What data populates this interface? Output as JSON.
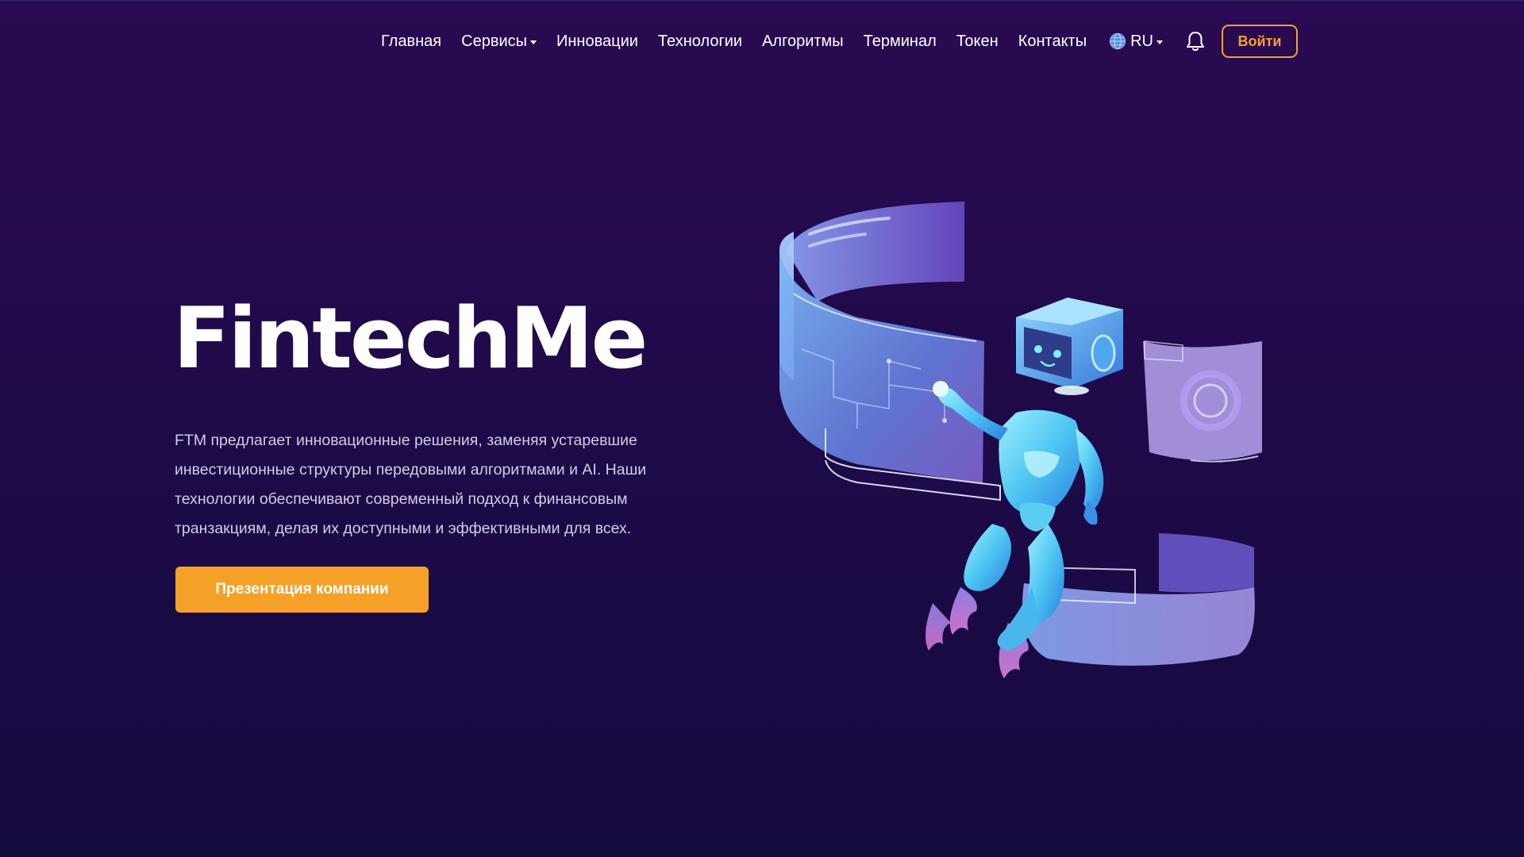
{
  "nav": {
    "items": [
      {
        "label": "Главная",
        "dropdown": false
      },
      {
        "label": "Сервисы",
        "dropdown": true
      },
      {
        "label": "Инновации",
        "dropdown": false
      },
      {
        "label": "Технологии",
        "dropdown": false
      },
      {
        "label": "Алгоритмы",
        "dropdown": false
      },
      {
        "label": "Терминал",
        "dropdown": false
      },
      {
        "label": "Токен",
        "dropdown": false
      },
      {
        "label": "Контакты",
        "dropdown": false
      }
    ],
    "language": "RU",
    "language_icon": "globe-icon",
    "notifications_icon": "bell-icon",
    "login_label": "Войти"
  },
  "hero": {
    "title": "FintechMe",
    "description": "FTM предлагает инновационные решения, заменяя устаревшие инвестиционные структуры передовыми алгоритмами и AI. Наши технологии обеспечивают современный подход к финансовым транзакциям, делая их доступными и эффективными для всех.",
    "cta_label": "Презентация компании",
    "illustration": "robot-illustration"
  },
  "colors": {
    "background_top": "#2a0a52",
    "background_bottom": "#150a3e",
    "accent": "#f5a128",
    "text": "#ffffff",
    "muted_text": "#d2cde0"
  }
}
